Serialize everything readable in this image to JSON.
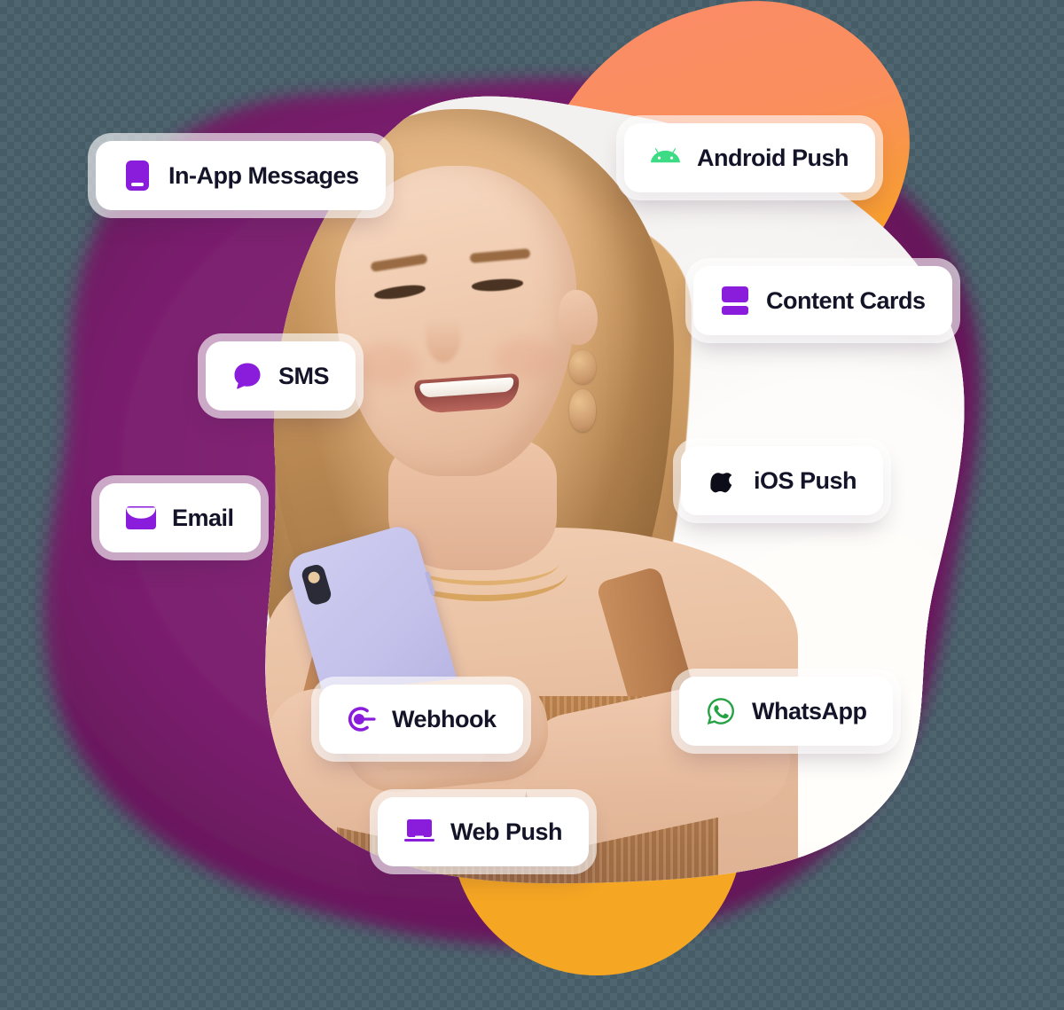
{
  "graphic": {
    "title": "Messaging channels",
    "background": {
      "purple_blob_color": "#7a1f6e",
      "purple_blob_color_dark": "#5e1154",
      "orange_top_from": "#fb8b6a",
      "orange_top_to": "#f7a83c",
      "orange_bottom": "#f5a623",
      "transparent_checker": "#4f6670"
    },
    "photo": {
      "alt": "Smiling woman with long blonde hair holding a lavender smartphone",
      "phone_case_color": "#c3c0ea",
      "outfit_color": "#b2794a"
    }
  },
  "badges": [
    {
      "id": "in-app-messages",
      "label": "In-App Messages",
      "icon": "mobile-phone-icon",
      "icon_color": "#8a1ddb"
    },
    {
      "id": "android-push",
      "label": "Android Push",
      "icon": "android-robot-icon",
      "icon_color": "#3ddc84"
    },
    {
      "id": "content-cards",
      "label": "Content Cards",
      "icon": "stacked-cards-icon",
      "icon_color": "#8a1ddb"
    },
    {
      "id": "sms",
      "label": "SMS",
      "icon": "speech-bubble-icon",
      "icon_color": "#8a1ddb"
    },
    {
      "id": "ios-push",
      "label": "iOS Push",
      "icon": "apple-logo-icon",
      "icon_color": "#0d0d1a"
    },
    {
      "id": "email",
      "label": "Email",
      "icon": "envelope-icon",
      "icon_color": "#8a1ddb"
    },
    {
      "id": "webhook",
      "label": "Webhook",
      "icon": "webhook-icon",
      "icon_color": "#8a1ddb"
    },
    {
      "id": "whatsapp",
      "label": "WhatsApp",
      "icon": "whatsapp-logo-icon",
      "icon_color": "#25a244"
    },
    {
      "id": "web-push",
      "label": "Web Push",
      "icon": "laptop-icon",
      "icon_color": "#8a1ddb"
    }
  ]
}
